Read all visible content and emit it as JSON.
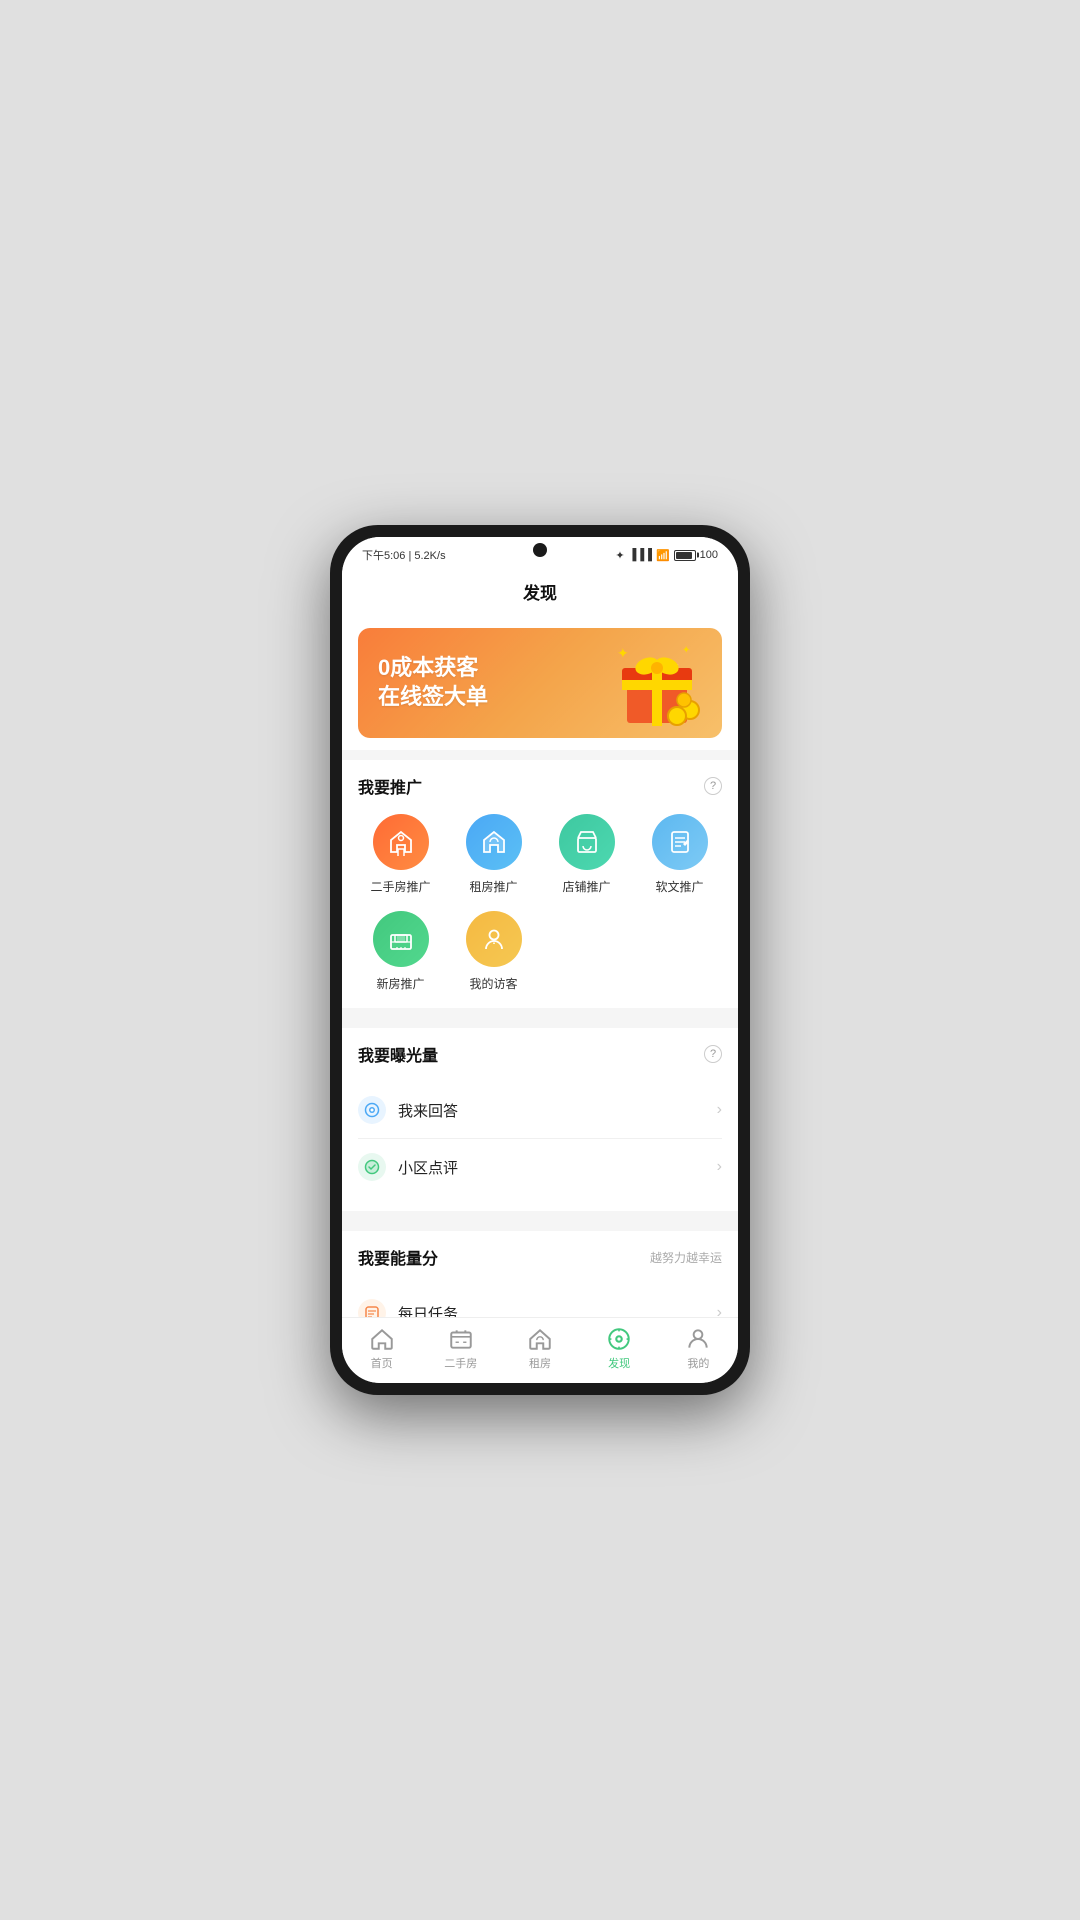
{
  "status": {
    "time": "下午5:06 | 5.2K/s",
    "sync_icon": "⟳",
    "battery": "100"
  },
  "header": {
    "title": "发现"
  },
  "banner": {
    "line1": "0成本获客",
    "line2": "在线签大单"
  },
  "promote_section": {
    "title": "我要推广",
    "items": [
      {
        "id": "second-hand",
        "label": "二手房推广",
        "color_class": "icon-red"
      },
      {
        "id": "rental",
        "label": "租房推广",
        "color_class": "icon-blue"
      },
      {
        "id": "shop",
        "label": "店铺推广",
        "color_class": "icon-teal"
      },
      {
        "id": "article",
        "label": "软文推广",
        "color_class": "icon-light-blue"
      },
      {
        "id": "new-house",
        "label": "新房推广",
        "color_class": "icon-green"
      },
      {
        "id": "visitors",
        "label": "我的访客",
        "color_class": "icon-yellow"
      }
    ]
  },
  "exposure_section": {
    "title": "我要曝光量",
    "items": [
      {
        "id": "answer",
        "label": "我来回答"
      },
      {
        "id": "review",
        "label": "小区点评"
      }
    ]
  },
  "energy_section": {
    "title": "我要能量分",
    "subtitle": "越努力越幸运",
    "items": [
      {
        "id": "daily-task",
        "label": "每日任务"
      }
    ]
  },
  "bottom_nav": {
    "items": [
      {
        "id": "home",
        "label": "首页",
        "active": false
      },
      {
        "id": "second-hand",
        "label": "二手房",
        "active": false
      },
      {
        "id": "rental",
        "label": "租房",
        "active": false
      },
      {
        "id": "discover",
        "label": "发现",
        "active": true
      },
      {
        "id": "profile",
        "label": "我的",
        "active": false
      }
    ]
  }
}
